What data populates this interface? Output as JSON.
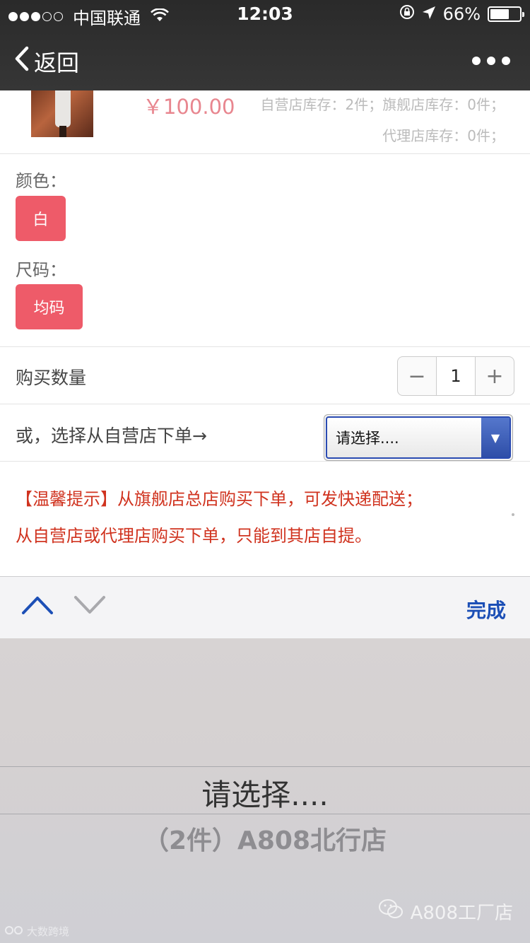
{
  "status_bar": {
    "carrier": "中国联通",
    "time": "12:03",
    "battery": "66%",
    "battery_level": 0.66
  },
  "nav": {
    "back_label": "返回"
  },
  "product": {
    "price": "￥100.00",
    "stock_line1": "自营店库存：2件；旗舰店库存：0件；",
    "stock_line2": "代理店库存：0件；"
  },
  "options": {
    "color_label": "颜色：",
    "color_value": "白",
    "size_label": "尺码：",
    "size_value": "均码"
  },
  "quantity": {
    "label": "购买数量",
    "minus": "−",
    "value": "1",
    "plus": "+"
  },
  "store_select": {
    "label": "或，选择从自营店下单→",
    "selected": "请选择...."
  },
  "tips": {
    "line1": "【温馨提示】从旗舰店总店购买下单，可发快递配送；",
    "line2": "从自营店或代理店购买下单，只能到其店自提。"
  },
  "accessory": {
    "done_label": "完成"
  },
  "picker": {
    "selected": "请选择....",
    "option": "（2件）A808北行店"
  },
  "watermarks": {
    "left": "大数跨境",
    "right": "A808工厂店"
  }
}
